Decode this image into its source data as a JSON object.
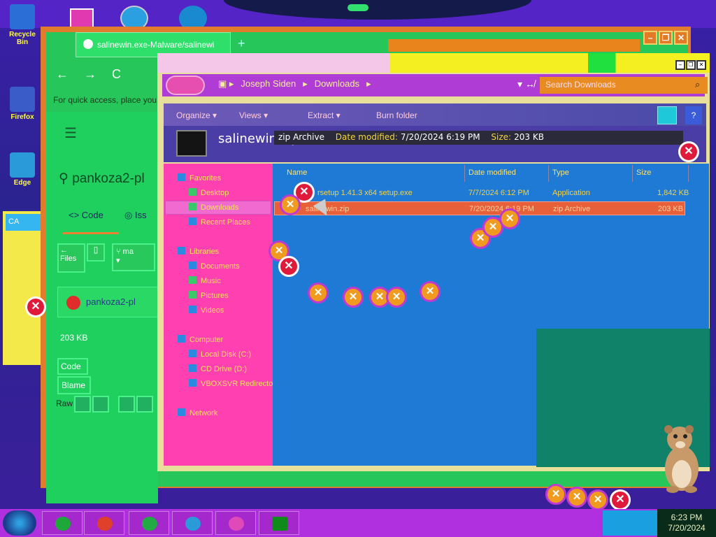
{
  "desktop": {
    "icons": [
      {
        "label": "Recycle Bin",
        "color": "#2b6fd6"
      },
      {
        "label": "Firefox",
        "color": "#3a5cc8"
      },
      {
        "label": "Edge",
        "color": "#2a9ad8"
      }
    ]
  },
  "browser": {
    "tab_title": "salinewin.exe-Malware/salinewi",
    "new_tab": "+",
    "window_controls": [
      "–",
      "❐",
      "✕"
    ],
    "nav": {
      "back": "←",
      "forward": "→",
      "reload": "C"
    },
    "quick_access_text": "For quick access, place your",
    "menu_icon": "☰",
    "repo_title": "pankoza2-pl",
    "tabs": {
      "code": "Code",
      "issues": "Iss"
    },
    "files_label": "Files",
    "branch_label": "ma",
    "file_owner": "pankoza2-pl",
    "file_size": "203 KB",
    "code_tab": "Code",
    "blame_tab": "Blame",
    "raw_label": "Raw"
  },
  "small_window": {
    "title": "CA"
  },
  "explorer": {
    "window_controls": [
      "–",
      "❐",
      "✕"
    ],
    "breadcrumb": [
      "Joseph Siden",
      "Downloads"
    ],
    "search_placeholder": "Search Downloads",
    "toolbar": {
      "organize": "Organize ▾",
      "views": "Views ▾",
      "extract": "Extract ▾",
      "burn": "Burn folder"
    },
    "details": {
      "file_name": "salinewin.zip",
      "type": "zip Archive",
      "date_modified_label": "Date modified:",
      "date_modified": "7/20/2024 6:19 PM",
      "size_label": "Size:",
      "size": "203 KB"
    },
    "nav_pane": {
      "favorites_header": "Favorites",
      "favorites": [
        "Desktop",
        "Downloads",
        "Recent Places"
      ],
      "libraries_header": "Libraries",
      "libraries": [
        "Documents",
        "Music",
        "Pictures",
        "Videos"
      ],
      "computer_header": "Computer",
      "computer": [
        "Local Disk (C:)",
        "CD Drive (D:)",
        "VBOXSVR Redirector"
      ],
      "network_header": "Network"
    },
    "columns": {
      "name": "Name",
      "date": "Date modified",
      "type": "Type",
      "size": "Size"
    },
    "files": [
      {
        "name": "rsetup 1.41.3 x64 setup.exe",
        "date": "7/7/2024 6:12 PM",
        "type": "Application",
        "size": "1,842 KB"
      },
      {
        "name": "salinewin.zip",
        "date": "7/20/2024 6:19 PM",
        "type": "zip Archive",
        "size": "203 KB"
      }
    ]
  },
  "taskbar": {
    "buttons": [
      {
        "name": "explorer",
        "color": "#1fa83a"
      },
      {
        "name": "chrome",
        "color": "#e0402a"
      },
      {
        "name": "ie",
        "color": "#22aa44"
      },
      {
        "name": "media-player",
        "color": "#2a9ad8"
      },
      {
        "name": "paint",
        "color": "#e04ab8"
      },
      {
        "name": "app",
        "color": "#108a1a"
      }
    ],
    "time": "6:23 PM",
    "date": "7/20/2024"
  }
}
